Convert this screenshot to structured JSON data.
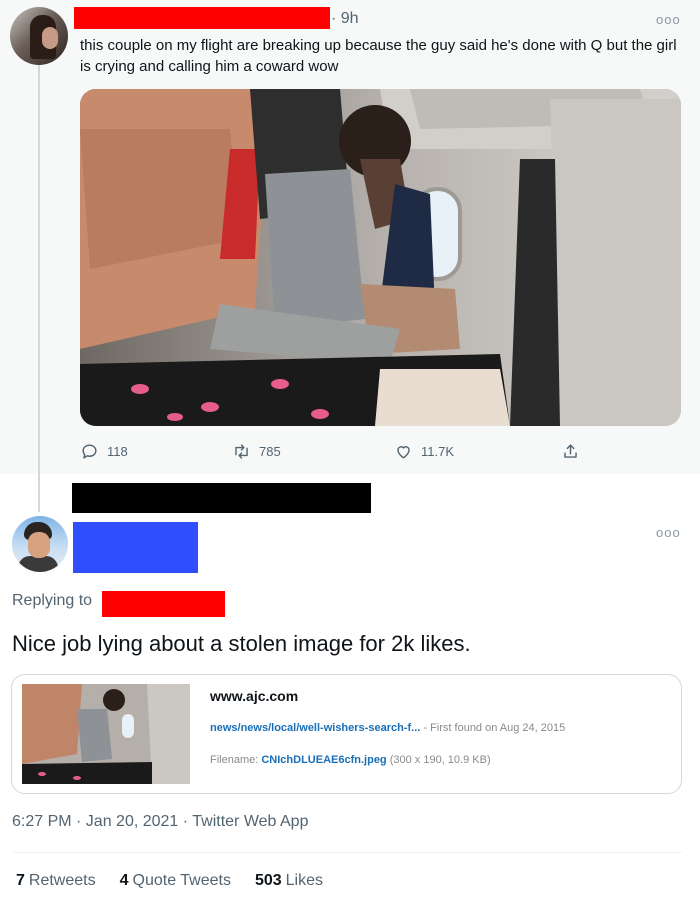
{
  "parent_tweet": {
    "time": "· 9h",
    "text": "this couple on my flight are breaking up because the guy said he's done with Q but the girl is crying and calling him a coward wow",
    "more": "ooo",
    "replies": "118",
    "retweets": "785",
    "likes": "11.7K"
  },
  "reply_tweet": {
    "more": "ooo",
    "replying_to": "Replying to",
    "text": "Nice job lying about a stolen image for 2k likes.",
    "card": {
      "domain": "www.ajc.com",
      "path": "news/news/local/well-wishers-search-f...",
      "first_found": " - First found on Aug 24, 2015",
      "filename_label": "Filename: ",
      "filename": "CNIchDLUEAE6cfn.jpeg",
      "file_info": " (300 x 190, 10.9 KB)"
    },
    "timestamp": "6:27 PM · Jan 20, 2021 · Twitter Web App",
    "stats": {
      "retweets_count": "7",
      "retweets_label": "Retweets",
      "quotes_count": "4",
      "quotes_label": "Quote Tweets",
      "likes_count": "503",
      "likes_label": "Likes"
    }
  },
  "colors": {
    "redaction_red": "#ff0000",
    "redaction_blue": "#2f4fff",
    "redaction_black": "#000000",
    "muted": "#536471"
  },
  "icons": [
    "reply-icon",
    "retweet-icon",
    "like-icon",
    "share-icon",
    "more-icon"
  ]
}
